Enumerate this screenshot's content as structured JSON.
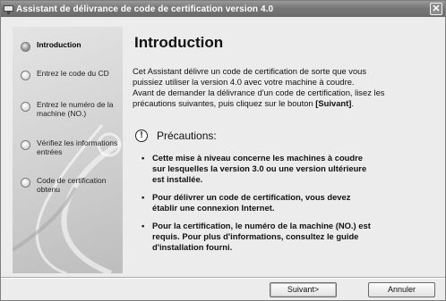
{
  "window": {
    "title": "Assistant de délivrance de code de certification version 4.0",
    "close_glyph": "✕",
    "icon": "app-window-icon"
  },
  "sidebar": {
    "steps": [
      {
        "label": "Introduction",
        "active": true
      },
      {
        "label": "Entrez le code du CD",
        "active": false
      },
      {
        "label": "Entrez le numéro de la machine (NO.)",
        "active": false
      },
      {
        "label": "Vérifiez les informations entrées",
        "active": false
      },
      {
        "label": "Code de certification obtenu",
        "active": false
      }
    ]
  },
  "main": {
    "heading": "Introduction",
    "intro_lines": [
      "Cet Assistant délivre un code de certification de sorte que vous",
      "puissiez utiliser la version 4.0 avec votre machine à coudre.",
      "Avant de demander la délivrance d'un code de certification, lisez les",
      "précautions suivantes, puis cliquez sur le bouton "
    ],
    "intro_emphasis": "[Suivant]",
    "intro_end": ".",
    "warning_icon_glyph": "!",
    "warning_title": "Précautions:",
    "bullet_glyph": "•",
    "bullets": [
      [
        "Cette mise à niveau concerne les machines à coudre",
        "sur lesquelles la version 3.0 ou une version ultérieure",
        "est installée."
      ],
      [
        "Pour délivrer un code de certification, vous devez",
        "établir une connexion Internet."
      ],
      [
        "Pour la certification, le numéro de la machine (NO.) est",
        "requis. Pour plus d'informations, consultez le guide",
        "d'installation fourni."
      ]
    ]
  },
  "buttons": {
    "next_label": "Suivant>",
    "cancel_label": "Annuler"
  },
  "colors": {
    "titlebar": "#777777",
    "dialog_bg": "#ececec",
    "sidebar_bg": "#d2d2d2"
  }
}
